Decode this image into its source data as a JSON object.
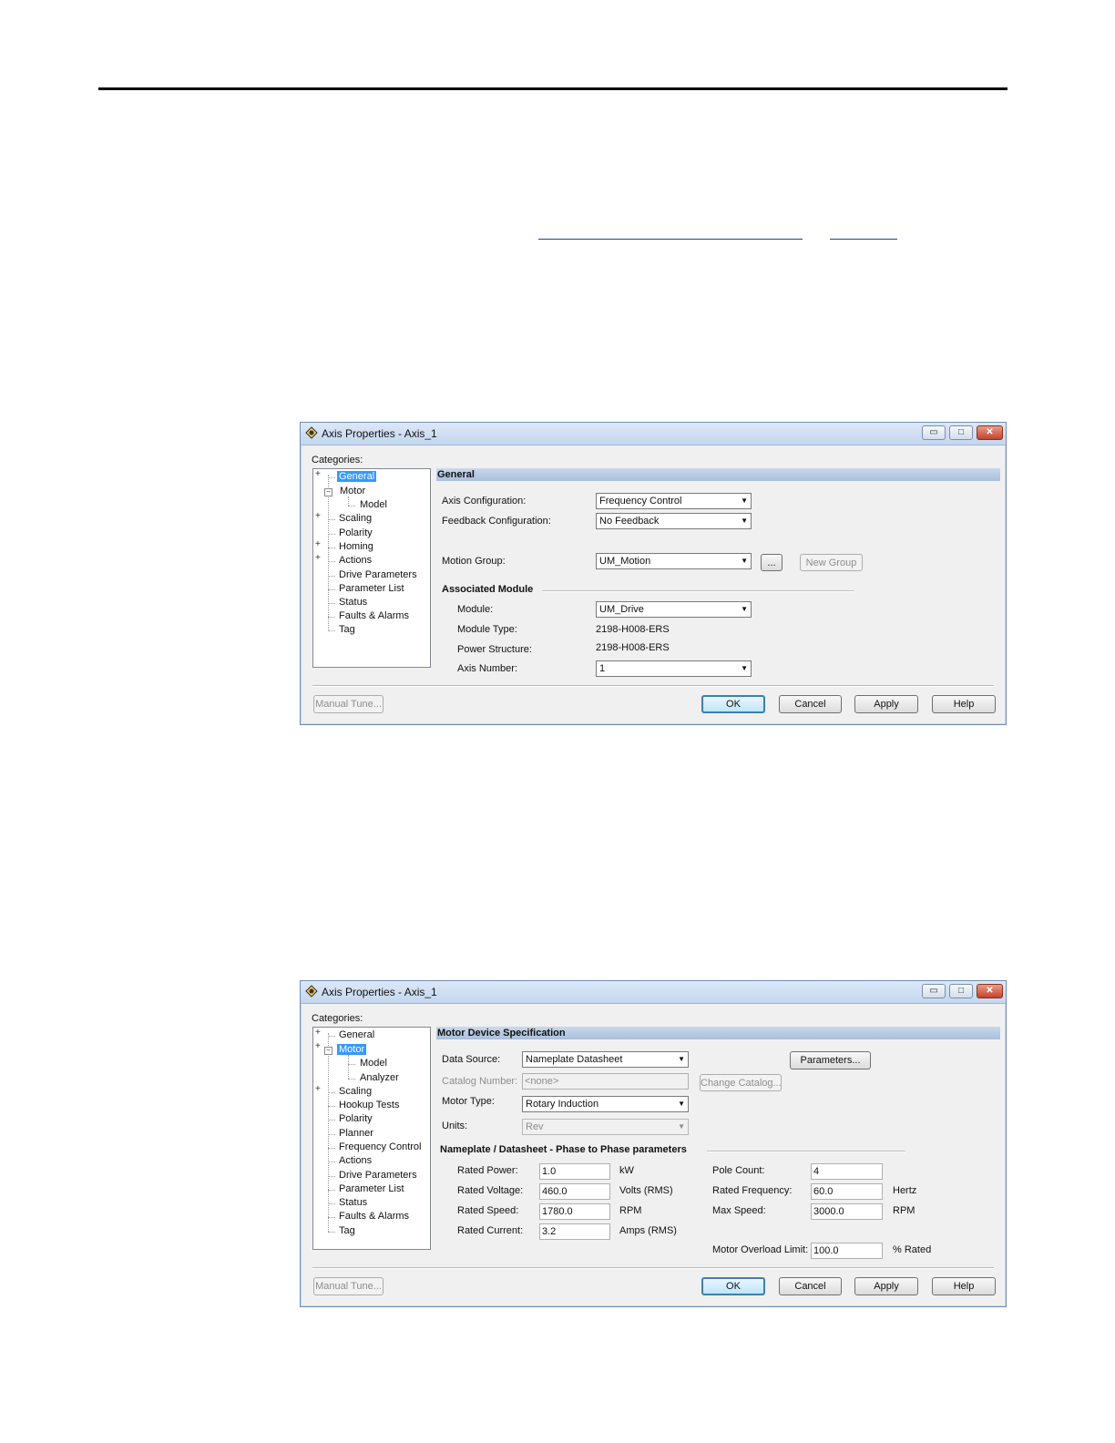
{
  "dialog1": {
    "title": "Axis Properties - Axis_1",
    "categories_label": "Categories:",
    "tree": [
      {
        "label": "General",
        "expander": "+",
        "selected": true
      },
      {
        "label": "Motor",
        "expander": "-"
      },
      {
        "label": "Model"
      },
      {
        "label": "Scaling",
        "expander": "+"
      },
      {
        "label": "Polarity"
      },
      {
        "label": "Homing",
        "expander": "+"
      },
      {
        "label": "Actions",
        "expander": "+"
      },
      {
        "label": "Drive Parameters"
      },
      {
        "label": "Parameter List"
      },
      {
        "label": "Status"
      },
      {
        "label": "Faults & Alarms"
      },
      {
        "label": "Tag"
      }
    ],
    "section_title": "General",
    "axis_config_label": "Axis Configuration:",
    "axis_config_value": "Frequency Control",
    "feedback_config_label": "Feedback Configuration:",
    "feedback_config_value": "No Feedback",
    "motion_group_label": "Motion Group:",
    "motion_group_value": "UM_Motion",
    "browse_label": "...",
    "new_group_label": "New Group",
    "assoc_module_title": "Associated Module",
    "module_label": "Module:",
    "module_value": "UM_Drive",
    "module_type_label": "Module Type:",
    "module_type_value": "2198-H008-ERS",
    "power_structure_label": "Power Structure:",
    "power_structure_value": "2198-H008-ERS",
    "axis_number_label": "Axis Number:",
    "axis_number_value": "1",
    "manual_tune_label": "Manual Tune...",
    "ok_label": "OK",
    "cancel_label": "Cancel",
    "apply_label": "Apply",
    "help_label": "Help"
  },
  "dialog2": {
    "title": "Axis Properties - Axis_1",
    "categories_label": "Categories:",
    "tree": [
      {
        "label": "General",
        "expander": "+"
      },
      {
        "label": "Motor",
        "expander": "-",
        "selected": true
      },
      {
        "label": "Model"
      },
      {
        "label": "Analyzer"
      },
      {
        "label": "Scaling",
        "expander": "+"
      },
      {
        "label": "Hookup Tests"
      },
      {
        "label": "Polarity"
      },
      {
        "label": "Planner"
      },
      {
        "label": "Frequency Control"
      },
      {
        "label": "Actions"
      },
      {
        "label": "Drive Parameters"
      },
      {
        "label": "Parameter List"
      },
      {
        "label": "Status"
      },
      {
        "label": "Faults & Alarms"
      },
      {
        "label": "Tag"
      }
    ],
    "section_title": "Motor Device Specification",
    "data_source_label": "Data Source:",
    "data_source_value": "Nameplate Datasheet",
    "parameters_label": "Parameters...",
    "catalog_number_label": "Catalog Number:",
    "catalog_number_value": "<none>",
    "change_catalog_label": "Change Catalog...",
    "motor_type_label": "Motor Type:",
    "motor_type_value": "Rotary Induction",
    "units_label": "Units:",
    "units_value": "Rev",
    "nameplate_title": "Nameplate / Datasheet - Phase to Phase parameters",
    "rated_power_label": "Rated Power:",
    "rated_power_value": "1.0",
    "rated_power_unit": "kW",
    "rated_voltage_label": "Rated Voltage:",
    "rated_voltage_value": "460.0",
    "rated_voltage_unit": "Volts (RMS)",
    "rated_speed_label": "Rated Speed:",
    "rated_speed_value": "1780.0",
    "rated_speed_unit": "RPM",
    "rated_current_label": "Rated Current:",
    "rated_current_value": "3.2",
    "rated_current_unit": "Amps (RMS)",
    "pole_count_label": "Pole Count:",
    "pole_count_value": "4",
    "rated_frequency_label": "Rated Frequency:",
    "rated_frequency_value": "60.0",
    "rated_frequency_unit": "Hertz",
    "max_speed_label": "Max Speed:",
    "max_speed_value": "3000.0",
    "max_speed_unit": "RPM",
    "overload_label": "Motor Overload Limit:",
    "overload_value": "100.0",
    "overload_unit": "% Rated",
    "manual_tune_label": "Manual Tune...",
    "ok_label": "OK",
    "cancel_label": "Cancel",
    "apply_label": "Apply",
    "help_label": "Help"
  }
}
